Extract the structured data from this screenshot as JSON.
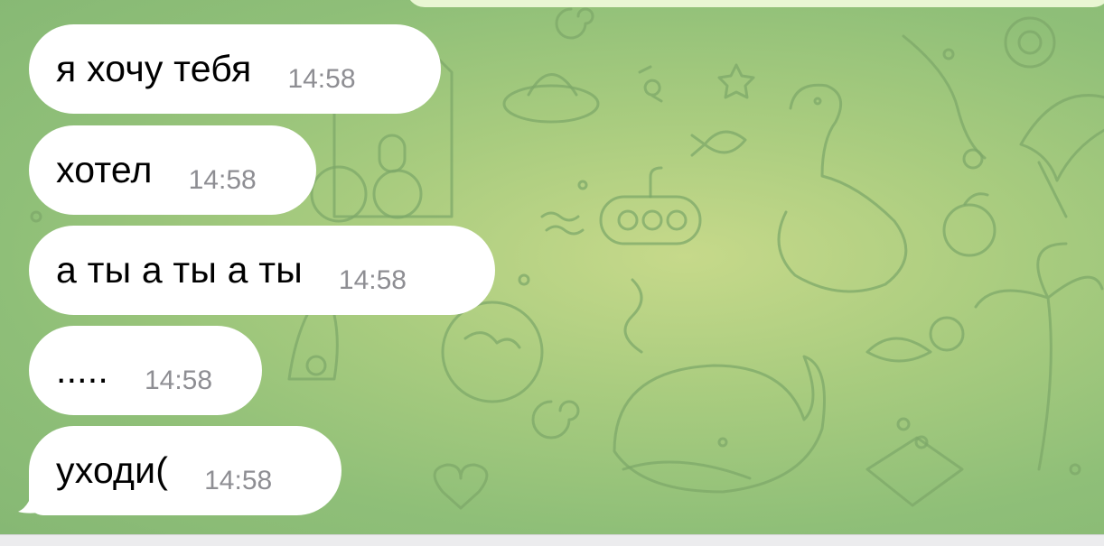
{
  "messages": [
    {
      "text": "я хочу тебя",
      "time": "14:58"
    },
    {
      "text": "хотел",
      "time": "14:58"
    },
    {
      "text": "а ты а ты а ты",
      "time": "14:58"
    },
    {
      "text": ".....",
      "time": "14:58"
    },
    {
      "text": "уходи(",
      "time": "14:58"
    }
  ],
  "colors": {
    "incoming_bubble": "#ffffff",
    "outgoing_bubble": "#e9f6d3",
    "timestamp": "#8e8e93",
    "wallpaper": "#a9cc7f"
  },
  "icons": [
    "doodle-wallpaper-pattern"
  ]
}
